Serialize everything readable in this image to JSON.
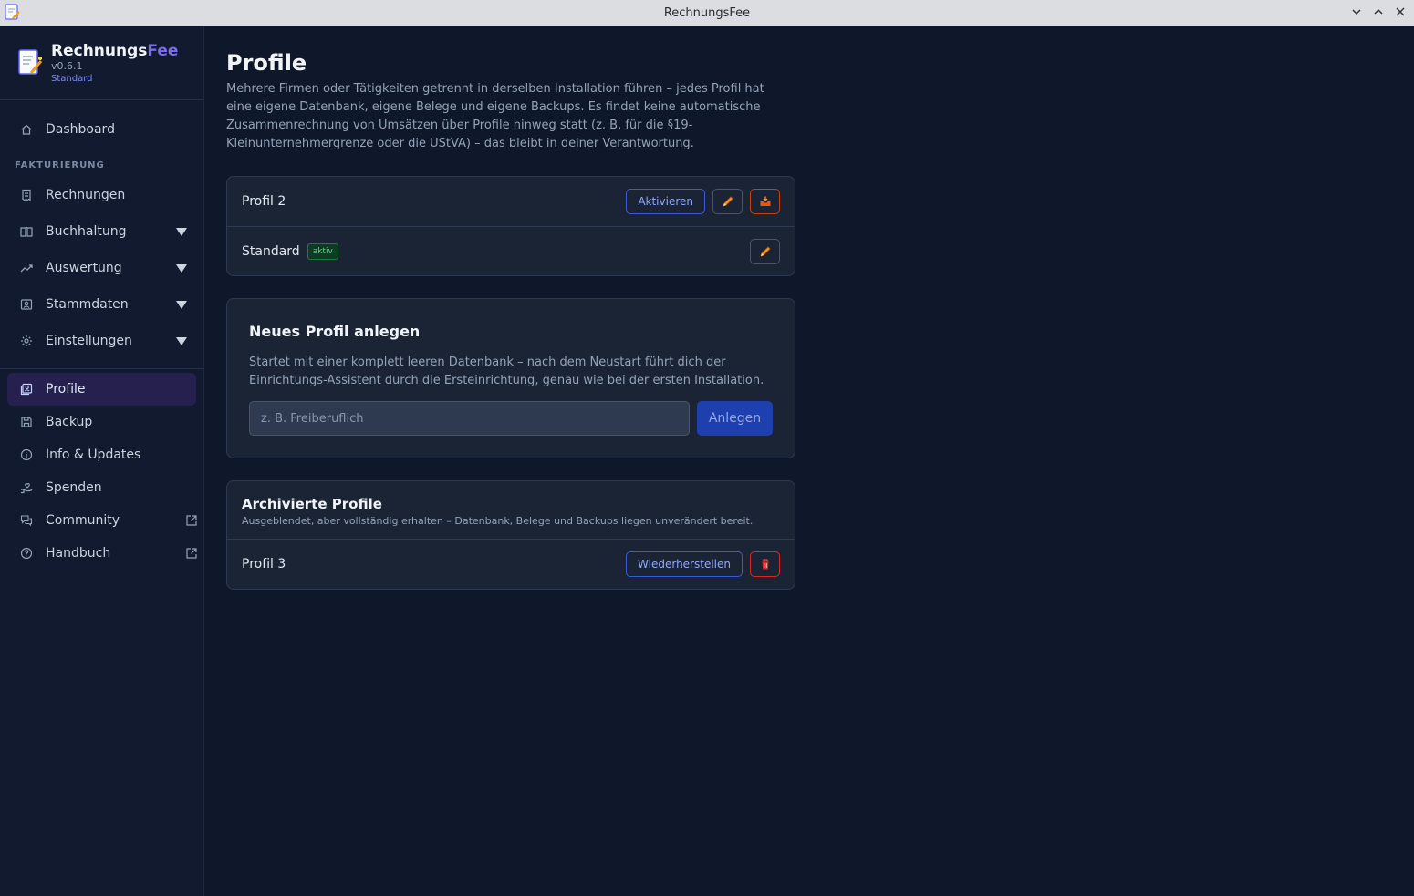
{
  "window": {
    "title": "RechnungsFee"
  },
  "brand": {
    "name_main": "Rechnungs",
    "name_accent": "Fee",
    "version": "v0.6.1",
    "profile": "Standard"
  },
  "nav": {
    "dashboard": "Dashboard",
    "section_fakturierung": "FAKTURIERUNG",
    "rechnungen": "Rechnungen",
    "buchhaltung": "Buchhaltung",
    "auswertung": "Auswertung",
    "stammdaten": "Stammdaten",
    "einstellungen": "Einstellungen",
    "profile": "Profile",
    "backup": "Backup",
    "info_updates": "Info & Updates",
    "spenden": "Spenden",
    "community": "Community",
    "handbuch": "Handbuch"
  },
  "page": {
    "title": "Profile",
    "description": "Mehrere Firmen oder Tätigkeiten getrennt in derselben Installation führen – jedes Profil hat eine eigene Datenbank, eigene Belege und eigene Backups. Es findet keine automatische Zusammenrechnung von Umsätzen über Profile hinweg statt (z. B. für die §19-Kleinunternehmergrenze oder die UStVA) – das bleibt in deiner Verantwortung."
  },
  "profiles": {
    "rows": [
      {
        "name": "Profil 2",
        "activate_label": "Aktivieren"
      },
      {
        "name": "Standard",
        "badge": "aktiv"
      }
    ]
  },
  "new_profile": {
    "title": "Neues Profil anlegen",
    "description": "Startet mit einer komplett leeren Datenbank – nach dem Neustart führt dich der Einrichtungs-Assistent durch die Ersteinrichtung, genau wie bei der ersten Installation.",
    "input_value": "",
    "input_placeholder": "z. B. Freiberuflich",
    "submit_label": "Anlegen"
  },
  "archived": {
    "title": "Archivierte Profile",
    "description": "Ausgeblendet, aber vollständig erhalten – Datenbank, Belege und Backups liegen unverändert bereit.",
    "rows": [
      {
        "name": "Profil 3",
        "restore_label": "Wiederherstellen"
      }
    ]
  },
  "icons": {
    "edit": "pencil-icon",
    "archive": "archive-tray-icon",
    "delete": "trash-icon"
  },
  "colors": {
    "accent": "#7c6cf0",
    "primary_button": "#1e40af",
    "active_badge": "#4ade80",
    "danger": "#dc2626",
    "warning": "#c2410c"
  }
}
